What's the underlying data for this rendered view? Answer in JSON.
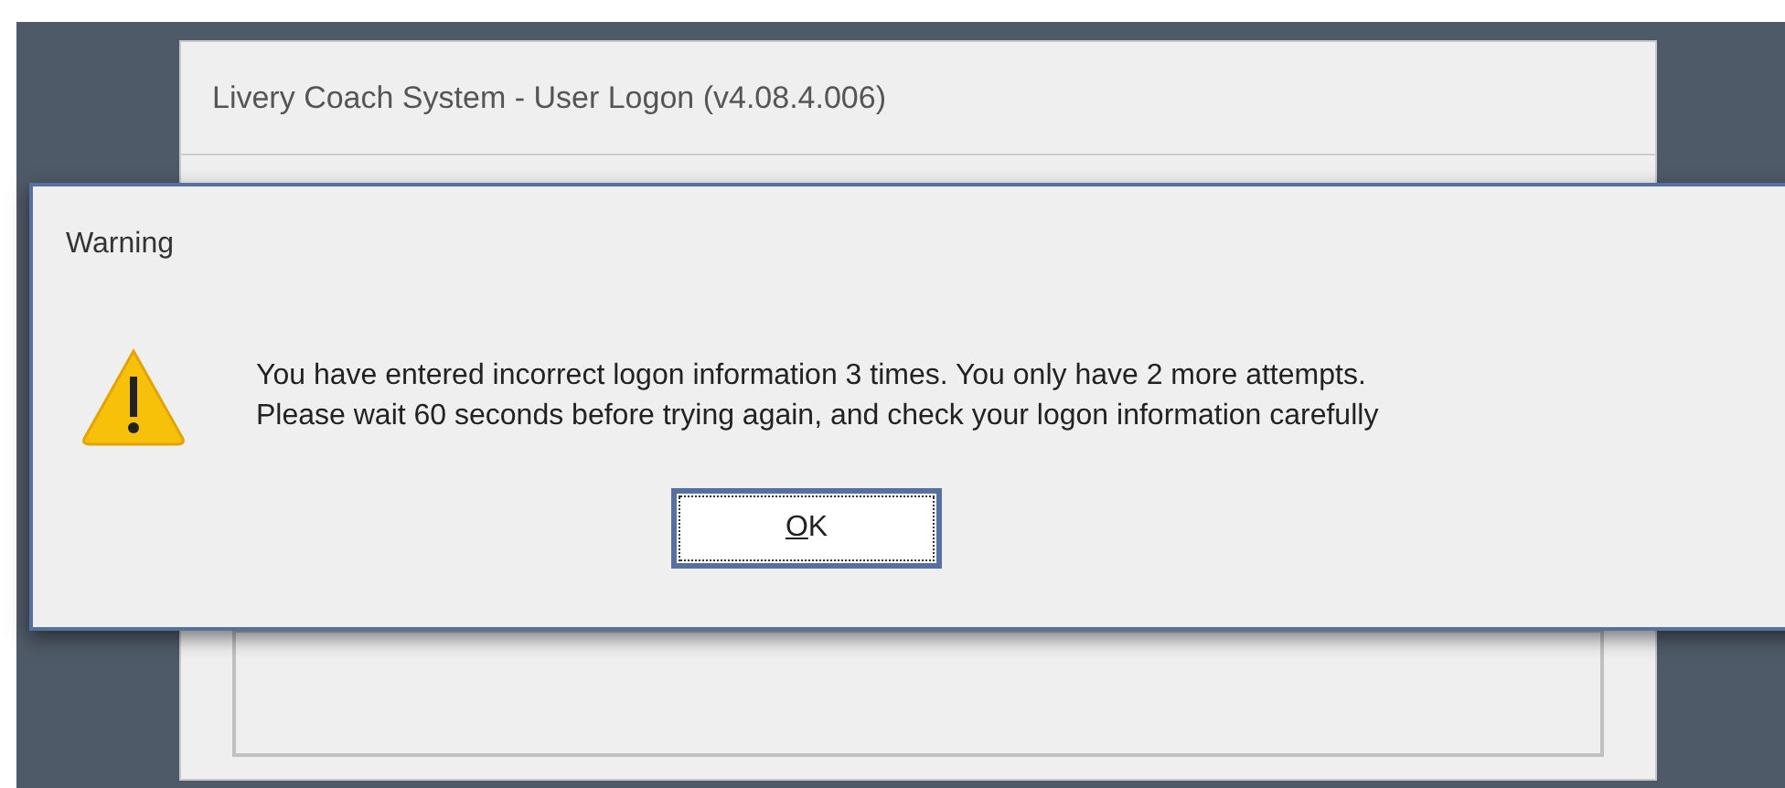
{
  "background_window": {
    "title": "Livery Coach System - User Logon (v4.08.4.006)"
  },
  "dialog": {
    "title": "Warning",
    "message_lines": [
      "You have entered incorrect logon information 3 times. You only have 2 more attempts.",
      "Please wait 60 seconds before trying again, and check your logon information carefully"
    ],
    "buttons": [
      {
        "label": "OK",
        "focused": true
      }
    ]
  }
}
